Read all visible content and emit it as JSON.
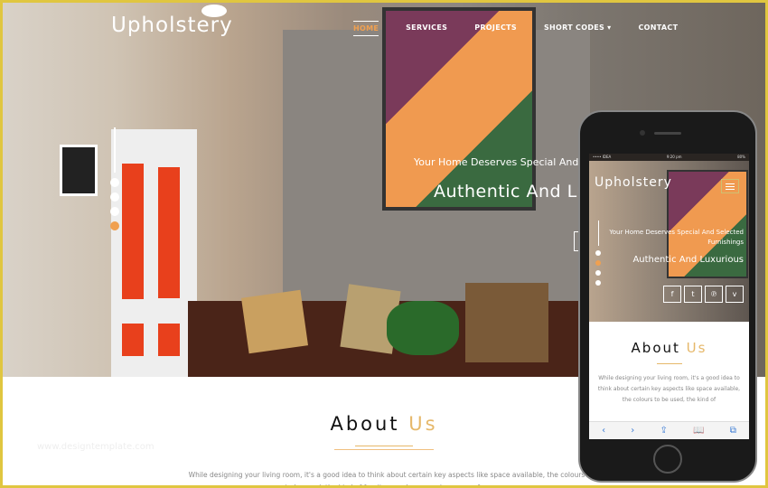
{
  "site": {
    "logo": "Upholstery"
  },
  "nav": {
    "items": [
      {
        "label": "HOME",
        "active": true
      },
      {
        "label": "SERVICES"
      },
      {
        "label": "PROJECTS"
      },
      {
        "label": "SHORT CODES ▾"
      },
      {
        "label": "CONTACT"
      }
    ]
  },
  "hero": {
    "subtitle": "Your Home Deserves Special And Selected Furnishings",
    "title": "Authentic And Luxurious",
    "slide_count": 4,
    "active_slide": 4
  },
  "about": {
    "title": "About",
    "title_accent": "Us",
    "text": "While designing your living room, it's a good idea to think about certain key aspects like space available, the colours to be used, the kind of furniture and accessories you prefer.",
    "watermark": "www.designtemplate.com"
  },
  "phone": {
    "status": {
      "carrier": "•••• IDEA",
      "time": "9:20 pm",
      "battery": "80%"
    },
    "social": [
      {
        "icon": "facebook-icon",
        "glyph": "f"
      },
      {
        "icon": "twitter-icon",
        "glyph": "t"
      },
      {
        "icon": "pinterest-icon",
        "glyph": "℗"
      },
      {
        "icon": "vimeo-icon",
        "glyph": "v"
      }
    ],
    "about_text": "While designing your living room, it's a good idea to think about certain key aspects like space available, the colours to be used, the kind of",
    "browser_bar": [
      "‹",
      "›",
      "⇪",
      "📖",
      "⧉"
    ]
  },
  "colors": {
    "accent": "#f0a050",
    "gold": "#e6b86a",
    "border": "#e0c640"
  }
}
